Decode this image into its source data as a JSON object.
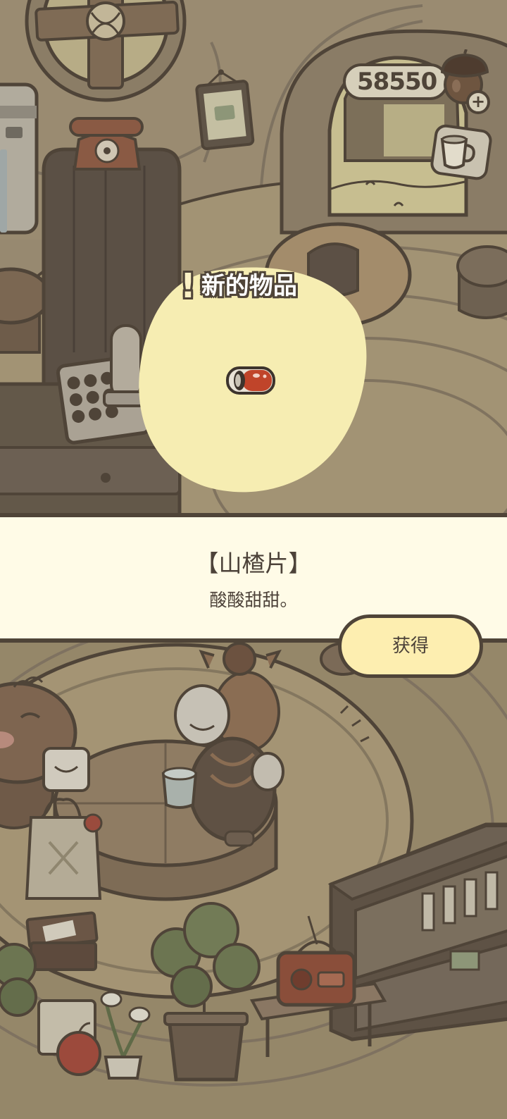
{
  "hud": {
    "coins": "58550",
    "add_label": "+"
  },
  "new_item": {
    "alert_mark": "!",
    "title": "新的物品"
  },
  "item": {
    "name": "【山楂片】",
    "description": "酸酸甜甜。",
    "icon": "hawthorn-flakes-icon"
  },
  "actions": {
    "obtain_label": "获得"
  },
  "icons": {
    "currency": "acorn-icon",
    "add_currency": "plus-icon",
    "side_button": "teacup-icon"
  },
  "colors": {
    "outline": "#4f4438",
    "panel": "#fffbe7",
    "button": "#fdeeb0",
    "highlight": "#f6edb2",
    "hud_pill": "#d6cfba",
    "text": "#4c4239",
    "item_red": "#c0442a"
  }
}
